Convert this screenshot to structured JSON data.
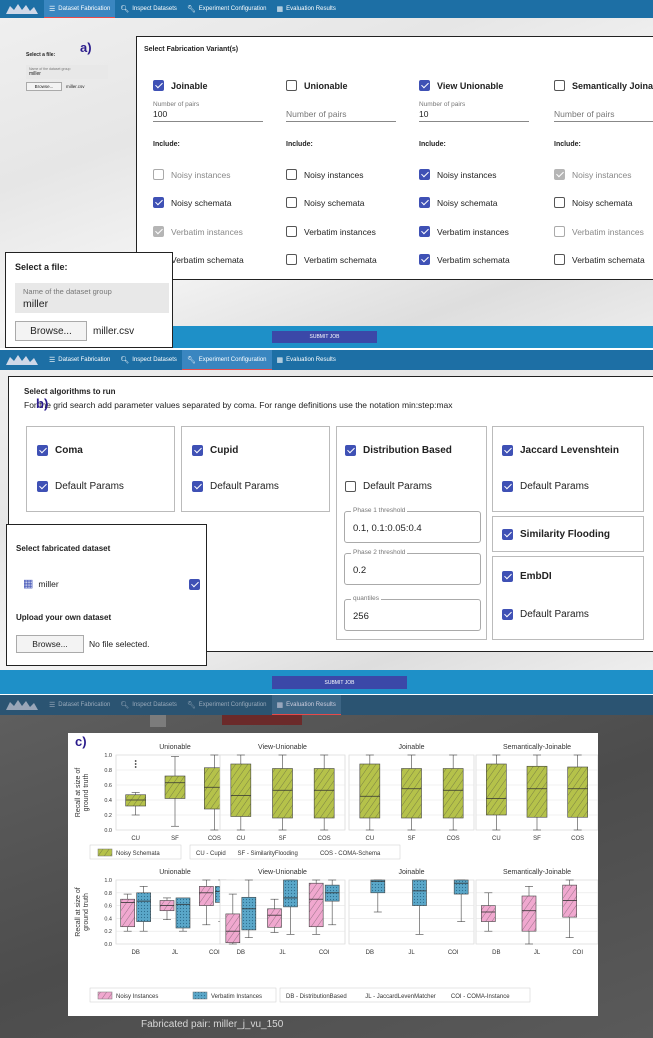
{
  "nav_tabs": [
    "Dataset Fabrication",
    "Inspect Datasets",
    "Experiment Configuration",
    "Evaluation Results"
  ],
  "panel_a": {
    "label": "a)",
    "left_file": {
      "title": "Select a file:",
      "field_label": "Name of the dataset group",
      "field_value": "miller",
      "browse": "Browse...",
      "filename": "miller.csv"
    },
    "variants_title": "Select Fabrication Variant(s)",
    "variants": [
      {
        "name": "Joinable",
        "checked": true,
        "pairs_label": "Number of pairs",
        "pairs": "100",
        "include": "Include:",
        "opts": [
          {
            "t": "Noisy instances",
            "c": false,
            "d": true
          },
          {
            "t": "Noisy schemata",
            "c": true,
            "d": false
          },
          {
            "t": "Verbatim instances",
            "c": true,
            "d": true
          },
          {
            "t": "Verbatim schemata",
            "c": true,
            "d": false
          }
        ]
      },
      {
        "name": "Unionable",
        "checked": false,
        "pairs_label": "",
        "pairs": "Number of pairs",
        "include": "Include:",
        "opts": [
          {
            "t": "Noisy instances",
            "c": false,
            "d": false
          },
          {
            "t": "Noisy schemata",
            "c": false,
            "d": false
          },
          {
            "t": "Verbatim instances",
            "c": false,
            "d": false
          },
          {
            "t": "Verbatim schemata",
            "c": false,
            "d": false
          }
        ]
      },
      {
        "name": "View Unionable",
        "checked": true,
        "pairs_label": "Number of pairs",
        "pairs": "10",
        "include": "Include:",
        "opts": [
          {
            "t": "Noisy instances",
            "c": true,
            "d": false
          },
          {
            "t": "Noisy schemata",
            "c": true,
            "d": false
          },
          {
            "t": "Verbatim instances",
            "c": true,
            "d": false
          },
          {
            "t": "Verbatim schemata",
            "c": true,
            "d": false
          }
        ]
      },
      {
        "name": "Semantically Joinable",
        "checked": false,
        "pairs_label": "",
        "pairs": "Number of pairs",
        "include": "Include:",
        "opts": [
          {
            "t": "Noisy instances",
            "c": true,
            "d": true
          },
          {
            "t": "Noisy schemata",
            "c": false,
            "d": false
          },
          {
            "t": "Verbatim instances",
            "c": false,
            "d": true
          },
          {
            "t": "Verbatim schemata",
            "c": false,
            "d": false
          }
        ]
      }
    ],
    "zoom_file": {
      "title": "Select a file:",
      "field_label": "Name of the dataset group",
      "field_value": "miller",
      "browse": "Browse...",
      "filename": "miller.csv"
    },
    "submit": "SUBMIT JOB"
  },
  "panel_b": {
    "label": "b)",
    "title": "Select algorithms to run",
    "subtitle": "For the grid search add parameter values separated by coma. For range definitions use the notation min:step:max",
    "algos": {
      "coma": {
        "name": "Coma",
        "checked": true,
        "default": "Default Params",
        "default_checked": true
      },
      "cupid": {
        "name": "Cupid",
        "checked": true,
        "default": "Default Params",
        "default_checked": true
      },
      "dist": {
        "name": "Distribution Based",
        "checked": true,
        "default": "Default Params",
        "default_checked": false,
        "params": [
          {
            "label": "Phase 1 threshold",
            "value": "0.1, 0.1:0.05:0.4"
          },
          {
            "label": "Phase 2 threshold",
            "value": "0.2"
          },
          {
            "label": "quantiles",
            "value": "256"
          }
        ]
      },
      "jl": {
        "name": "Jaccard Levenshtein",
        "checked": true,
        "default": "Default Params",
        "default_checked": true
      },
      "sf": {
        "name": "Similarity Flooding",
        "checked": true
      },
      "embdi": {
        "name": "EmbDI",
        "checked": true,
        "default": "Default Params",
        "default_checked": true
      }
    },
    "fab_dataset": {
      "title": "Select fabricated dataset",
      "item": "miller",
      "item_checked": true,
      "upload_title": "Upload your own dataset",
      "browse": "Browse...",
      "no_file": "No file selected."
    },
    "submit": "SUBMIT JOB"
  },
  "panel_c": {
    "label": "c)",
    "ylabel": "Recall at size of\nground truth",
    "footer": "Fabricated pair: miller_j_vu_150"
  },
  "chart_data": [
    {
      "type": "box",
      "panels": [
        "Unionable",
        "View-Unionable",
        "Joinable",
        "Semantically-Joinable"
      ],
      "categories": [
        "CU",
        "SF",
        "COS"
      ],
      "ylabel": "Recall at size of ground truth",
      "ylim": [
        0,
        1.0
      ],
      "yticks": [
        "0.0",
        "0.2",
        "0.4",
        "0.6",
        "0.8",
        "1.0"
      ],
      "series": [
        {
          "name": "Noisy Schemata",
          "color": "#b5c24a",
          "boxes": [
            [
              [
                0.2,
                0.32,
                0.4,
                0.47,
                0.5
              ],
              [
                0.05,
                0.42,
                0.63,
                0.72,
                0.98
              ],
              [
                0,
                0.28,
                0.57,
                0.83,
                1.0
              ]
            ],
            [
              [
                0,
                0.18,
                0.46,
                0.88,
                1.0
              ],
              [
                0,
                0.16,
                0.53,
                0.82,
                1.0
              ],
              [
                0,
                0.16,
                0.53,
                0.82,
                1.0
              ]
            ],
            [
              [
                0,
                0.16,
                0.45,
                0.88,
                1.0
              ],
              [
                0,
                0.16,
                0.55,
                0.82,
                1.0
              ],
              [
                0,
                0.16,
                0.53,
                0.82,
                1.0
              ]
            ],
            [
              [
                0,
                0.2,
                0.42,
                0.88,
                1.0
              ],
              [
                0,
                0.17,
                0.55,
                0.85,
                1.0
              ],
              [
                0,
                0.17,
                0.55,
                0.84,
                1.0
              ]
            ]
          ],
          "outliers": [
            [
              [
                0.84,
                0.88,
                0.92
              ],
              [],
              []
            ],
            [
              [],
              [],
              []
            ],
            [
              [],
              [],
              []
            ],
            [
              [],
              [],
              []
            ]
          ]
        }
      ],
      "legend": [
        "Noisy Schemata",
        "CU - Cupid",
        "SF - SimilarityFlooding",
        "COS - COMA-Schema"
      ]
    },
    {
      "type": "box",
      "panels": [
        "Unionable",
        "View-Unionable",
        "Joinable",
        "Semantically-Joinable"
      ],
      "categories": [
        "DB",
        "JL",
        "COI"
      ],
      "ylabel": "Recall at size of ground truth",
      "ylim": [
        0,
        1.0
      ],
      "yticks": [
        "0.0",
        "0.2",
        "0.4",
        "0.6",
        "0.8",
        "1.0"
      ],
      "series": [
        {
          "name": "Noisy Instances",
          "color": "#f0a8cf",
          "boxes": [
            [
              [
                0.2,
                0.27,
                0.65,
                0.7,
                0.78
              ],
              [
                0.38,
                0.52,
                0.6,
                0.68,
                0.72
              ],
              [
                0.3,
                0.6,
                0.8,
                0.9,
                1.0
              ]
            ],
            [
              [
                0,
                0.02,
                0.2,
                0.47,
                0.78
              ],
              [
                0.18,
                0.26,
                0.45,
                0.55,
                0.7
              ],
              [
                0.15,
                0.27,
                0.7,
                0.95,
                1.0
              ]
            ],
            [
              null,
              null,
              null
            ],
            [
              [
                0.2,
                0.35,
                0.5,
                0.6,
                0.8
              ],
              [
                0,
                0.2,
                0.52,
                0.75,
                0.9
              ],
              [
                0.1,
                0.42,
                0.68,
                0.92,
                1.0
              ]
            ]
          ]
        },
        {
          "name": "Verbatim Instances",
          "color": "#5aa7c9",
          "boxes": [
            [
              [
                0.2,
                0.35,
                0.67,
                0.8,
                0.9
              ],
              [
                0.2,
                0.25,
                0.62,
                0.72,
                0.7
              ],
              [
                0.35,
                0.65,
                0.82,
                0.9,
                1.0
              ]
            ],
            [
              [
                0.1,
                0.22,
                0.55,
                0.73,
                1.0
              ],
              [
                0.15,
                0.58,
                0.72,
                1.0,
                1.0
              ],
              [
                0.3,
                0.67,
                0.8,
                0.92,
                1.0
              ]
            ],
            [
              [
                0.5,
                0.8,
                0.98,
                1.0,
                1.0
              ],
              [
                0.15,
                0.6,
                0.83,
                1.0,
                1.0
              ],
              [
                0.35,
                0.78,
                0.95,
                1.0,
                1.0
              ]
            ],
            [
              null,
              null,
              null
            ]
          ]
        }
      ],
      "legend": [
        "Noisy Instances",
        "Verbatim Instances",
        "DB - DistributionBased",
        "JL - JaccardLevenMatcher",
        "COI - COMA-Instance"
      ]
    }
  ]
}
